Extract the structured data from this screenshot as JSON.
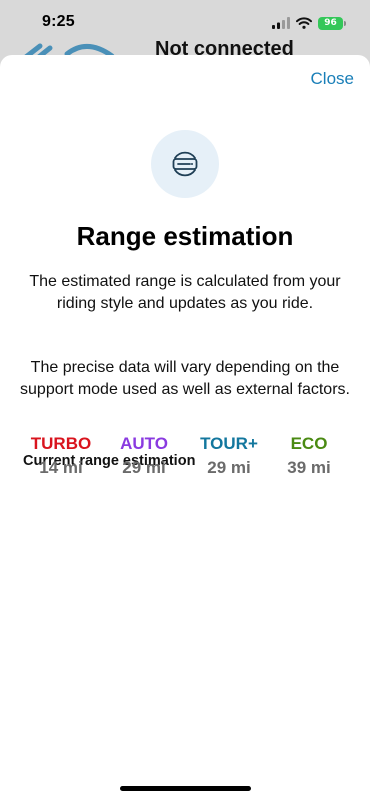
{
  "status_bar": {
    "time": "9:25",
    "battery_level": "96",
    "icons": [
      "signal-icon",
      "wifi-icon",
      "battery-charging-icon"
    ]
  },
  "background": {
    "title": "Not connected",
    "logo_icon": "bike-logo-icon"
  },
  "sheet": {
    "close_label": "Close",
    "header_icon": "battery-range-icon",
    "title": "Range estimation",
    "description_1": "The estimated range is calculated from your riding style and updates as you ride.",
    "description_2": "The precise data will vary depending on the support mode used as well as external factors.",
    "section_label": "Current range estimation",
    "modes": [
      {
        "name": "TURBO",
        "range": "14 mi",
        "color": "#d9141e"
      },
      {
        "name": "AUTO",
        "range": "29 mi",
        "color": "#8a3ae0"
      },
      {
        "name": "TOUR+",
        "range": "29 mi",
        "color": "#13779e"
      },
      {
        "name": "ECO",
        "range": "39 mi",
        "color": "#4a8a12"
      }
    ]
  },
  "colors": {
    "accent": "#1a7fb8",
    "icon_bg": "#e6f0f8",
    "battery_green": "#34c759"
  }
}
